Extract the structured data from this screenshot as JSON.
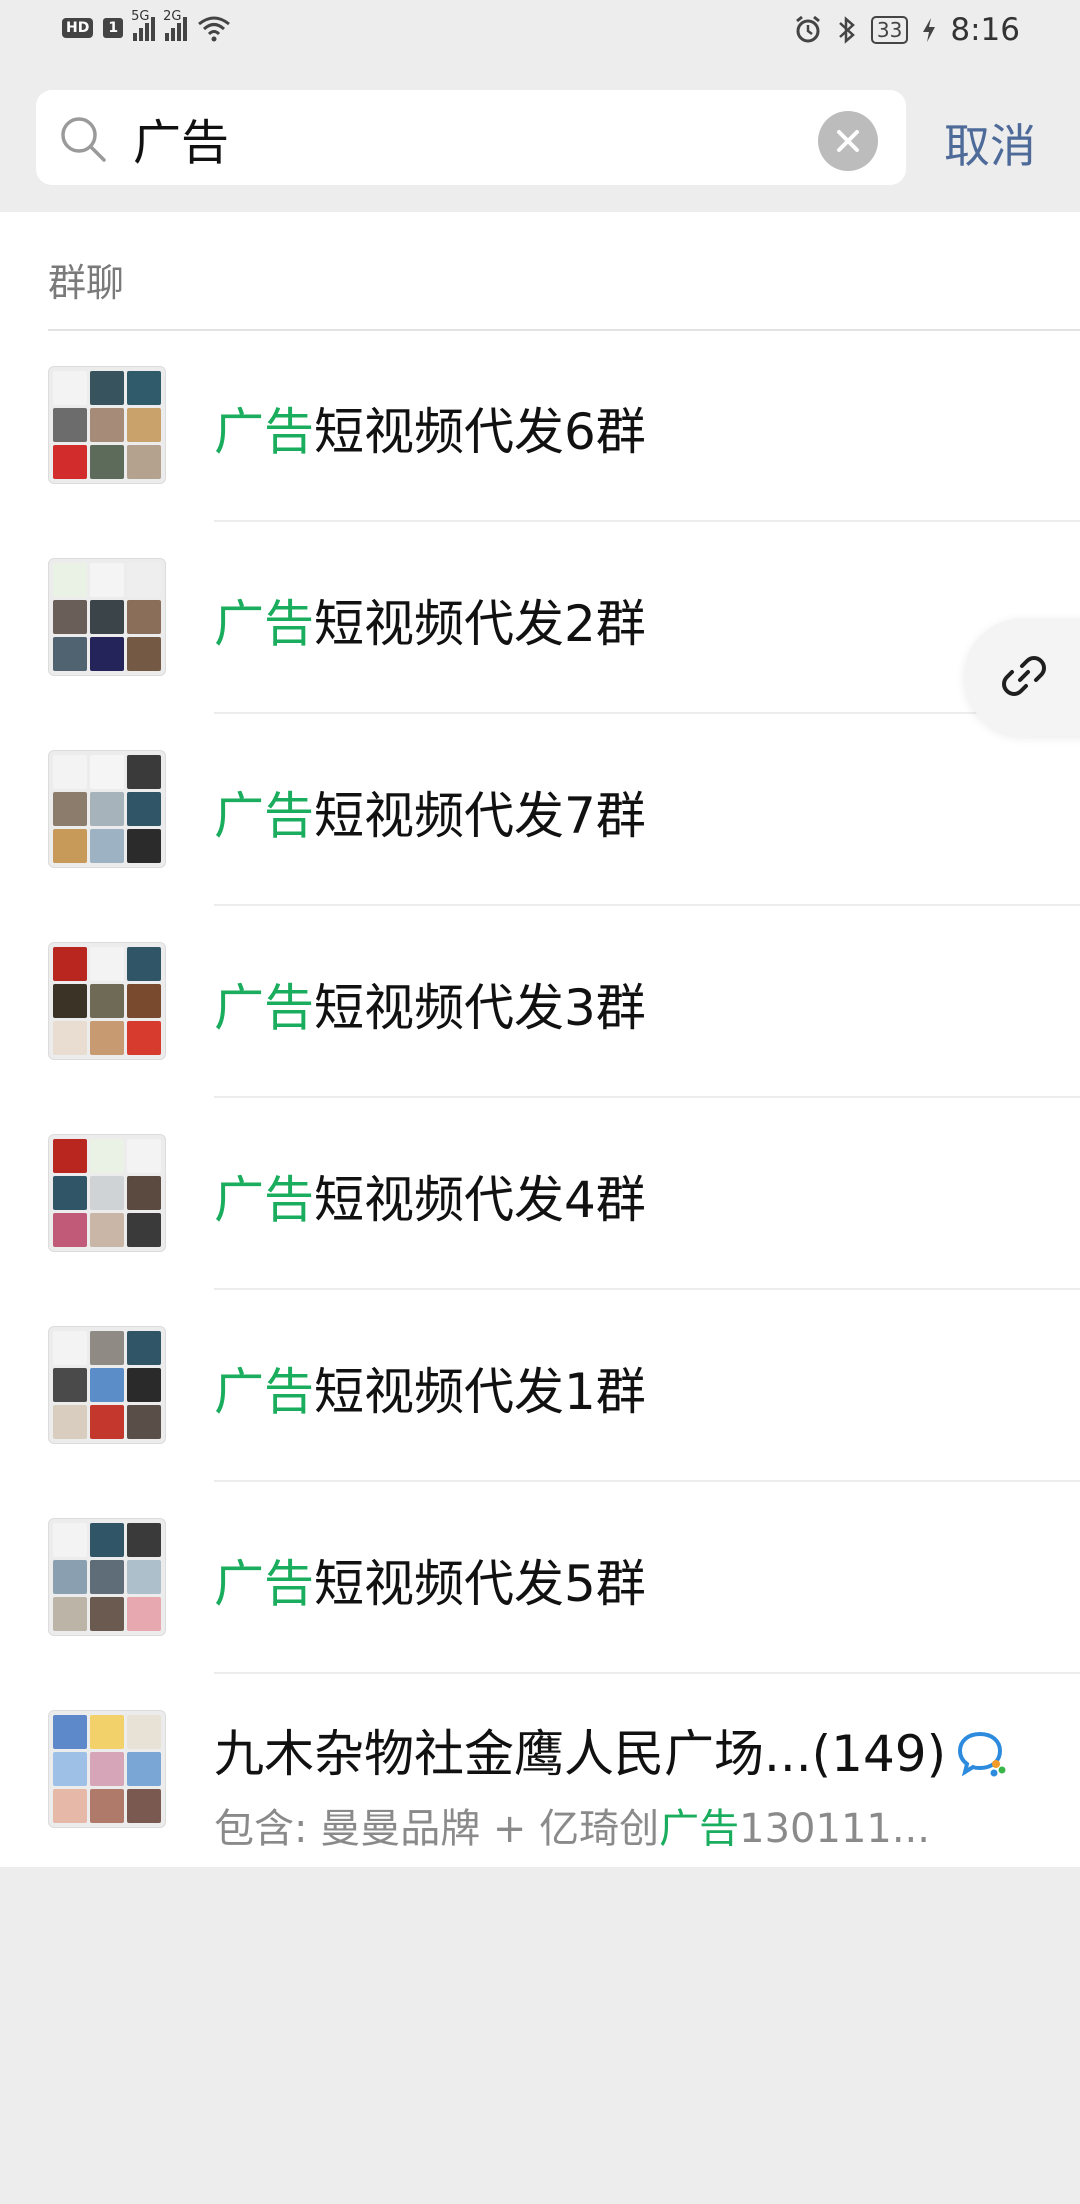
{
  "status_bar": {
    "hd": "HD",
    "sim": "1",
    "sig1_label": "5G",
    "sig2_label": "2G",
    "battery": "33",
    "time": "8:16"
  },
  "search": {
    "value": "广告",
    "cancel_label": "取消"
  },
  "section_title": "群聊",
  "highlight_color": "#1aad5e",
  "results": [
    {
      "highlight": "广告",
      "rest": "短视频代发6群"
    },
    {
      "highlight": "广告",
      "rest": "短视频代发2群"
    },
    {
      "highlight": "广告",
      "rest": "短视频代发7群"
    },
    {
      "highlight": "广告",
      "rest": "短视频代发3群"
    },
    {
      "highlight": "广告",
      "rest": "短视频代发4群"
    },
    {
      "highlight": "广告",
      "rest": "短视频代发1群"
    },
    {
      "highlight": "广告",
      "rest": "短视频代发5群"
    }
  ],
  "last_result": {
    "title": "九木杂物社金鹰人民广场...(149)",
    "sub_prefix": "包含: 曼曼品牌 + 亿琦创",
    "sub_highlight": "广告",
    "sub_suffix": "130111..."
  }
}
